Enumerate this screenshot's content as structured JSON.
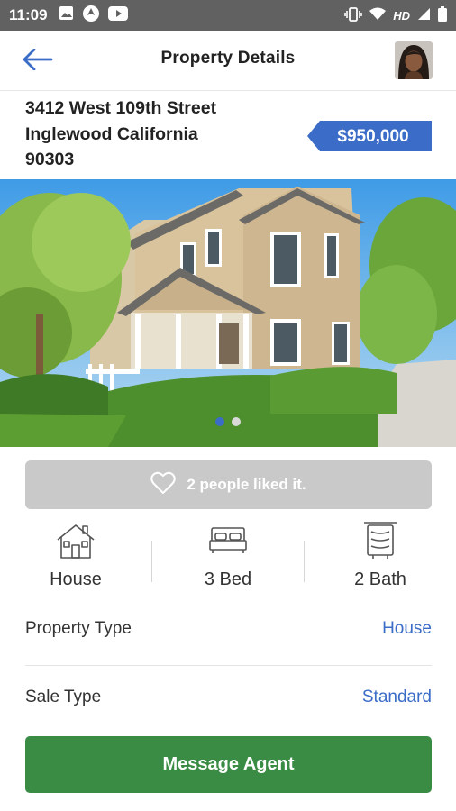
{
  "status_bar": {
    "time": "11:09",
    "left_icons": [
      "image-icon",
      "app-icon",
      "youtube-icon"
    ],
    "network_label": "HD"
  },
  "header": {
    "title": "Property Details",
    "back_icon": "arrow-left-icon",
    "avatar_icon": "user-avatar"
  },
  "property": {
    "address_line1": "3412 West 109th Street",
    "address_line2": "Inglewood California",
    "address_line3": "90303",
    "price": "$950,000"
  },
  "gallery": {
    "image_count": 2,
    "active_index": 0,
    "colors": {
      "active_dot": "#3b6cc7",
      "inactive_dot": "#d9d9d9"
    }
  },
  "likes": {
    "text": "2 people liked it.",
    "icon": "heart-outline-icon"
  },
  "features": [
    {
      "icon": "house-icon",
      "label": "House"
    },
    {
      "icon": "bed-icon",
      "label": "3 Bed"
    },
    {
      "icon": "bath-icon",
      "label": "2 Bath"
    }
  ],
  "details": [
    {
      "label": "Property Type",
      "value": "House"
    },
    {
      "label": "Sale Type",
      "value": "Standard"
    }
  ],
  "actions": {
    "message_agent": "Message Agent"
  },
  "colors": {
    "accent": "#3b6cc7",
    "primary_button": "#3a8c45",
    "likes_background": "#c9c9c9",
    "status_bar": "#616161"
  }
}
